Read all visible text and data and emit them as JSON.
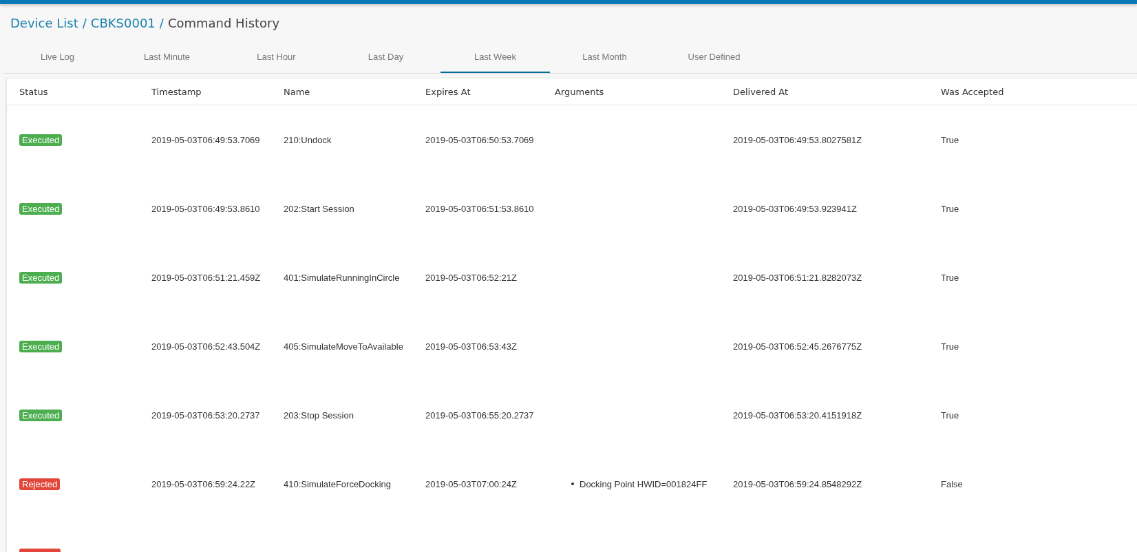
{
  "breadcrumb": {
    "links": [
      "Device List",
      "CBKS0001"
    ],
    "separator": "/",
    "current": "Command History"
  },
  "tabs": [
    {
      "label": "Live Log",
      "selected": false
    },
    {
      "label": "Last Minute",
      "selected": false
    },
    {
      "label": "Last Hour",
      "selected": false
    },
    {
      "label": "Last Day",
      "selected": false
    },
    {
      "label": "Last Week",
      "selected": true
    },
    {
      "label": "Last Month",
      "selected": false
    },
    {
      "label": "User Defined",
      "selected": false
    }
  ],
  "table": {
    "columns": [
      "Status",
      "Timestamp",
      "Name",
      "Expires At",
      "Arguments",
      "Delivered At",
      "Was Accepted"
    ],
    "rows": [
      {
        "status": {
          "kind": "executed",
          "label": "Executed"
        },
        "timestamp": "2019-05-03T06:49:53.7069",
        "name": "210:Undock",
        "expires_at": "2019-05-03T06:50:53.7069",
        "delivered_at": "2019-05-03T06:49:53.8027581Z",
        "was_accepted": "True"
      },
      {
        "status": {
          "kind": "executed",
          "label": "Executed"
        },
        "timestamp": "2019-05-03T06:49:53.8610",
        "name": "202:Start Session",
        "expires_at": "2019-05-03T06:51:53.8610",
        "delivered_at": "2019-05-03T06:49:53.923941Z",
        "was_accepted": "True"
      },
      {
        "status": {
          "kind": "executed",
          "label": "Executed"
        },
        "timestamp": "2019-05-03T06:51:21.459Z",
        "name": "401:SimulateRunningInCircle",
        "expires_at": "2019-05-03T06:52:21Z",
        "delivered_at": "2019-05-03T06:51:21.8282073Z",
        "was_accepted": "True"
      },
      {
        "status": {
          "kind": "executed",
          "label": "Executed"
        },
        "timestamp": "2019-05-03T06:52:43.504Z",
        "name": "405:SimulateMoveToAvailable",
        "expires_at": "2019-05-03T06:53:43Z",
        "delivered_at": "2019-05-03T06:52:45.2676775Z",
        "was_accepted": "True"
      },
      {
        "status": {
          "kind": "executed",
          "label": "Executed"
        },
        "timestamp": "2019-05-03T06:53:20.2737",
        "name": "203:Stop Session",
        "expires_at": "2019-05-03T06:55:20.2737",
        "delivered_at": "2019-05-03T06:53:20.4151918Z",
        "was_accepted": "True"
      },
      {
        "status": {
          "kind": "rejected",
          "label": "Rejected"
        },
        "timestamp": "2019-05-03T06:59:24.22Z",
        "name": "410:SimulateForceDocking",
        "expires_at": "2019-05-03T07:00:24Z",
        "arguments": [
          "Docking Point HWID=001824FF"
        ],
        "delivered_at": "2019-05-03T06:59:24.8548292Z",
        "was_accepted": "False"
      },
      {
        "status": {
          "kind": "rejected"
        }
      }
    ]
  }
}
